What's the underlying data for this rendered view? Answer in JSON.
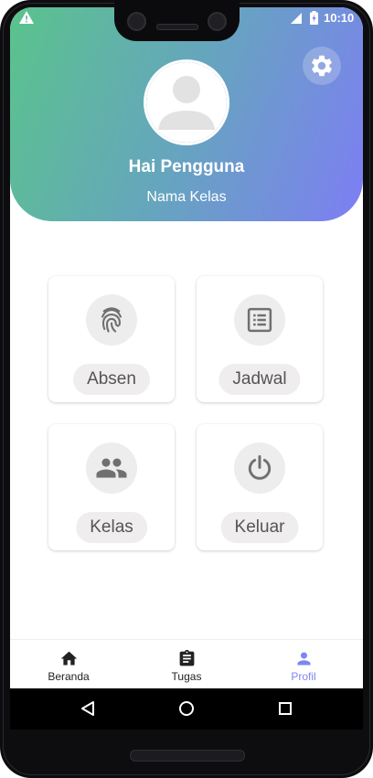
{
  "status_bar": {
    "time": "10:10",
    "icons": [
      "warning-icon",
      "signal-icon",
      "battery-icon"
    ]
  },
  "header": {
    "greeting": "Hai Pengguna",
    "class_name": "Nama Kelas",
    "settings_icon": "gear-icon",
    "avatar_icon": "person-icon"
  },
  "menu": {
    "items": [
      {
        "label": "Absen",
        "icon": "fingerprint-icon"
      },
      {
        "label": "Jadwal",
        "icon": "list-icon"
      },
      {
        "label": "Kelas",
        "icon": "people-icon"
      },
      {
        "label": "Keluar",
        "icon": "power-icon"
      }
    ]
  },
  "bottom_nav": {
    "items": [
      {
        "label": "Beranda",
        "icon": "home-icon",
        "active": false
      },
      {
        "label": "Tugas",
        "icon": "clipboard-icon",
        "active": false
      },
      {
        "label": "Profil",
        "icon": "person-icon",
        "active": true
      }
    ]
  },
  "colors": {
    "gradient_start": "#5ac38c",
    "gradient_end": "#7d7ef4",
    "active_nav": "#7f85f3",
    "icon_gray": "#707070",
    "card_label_bg": "#efeded"
  }
}
